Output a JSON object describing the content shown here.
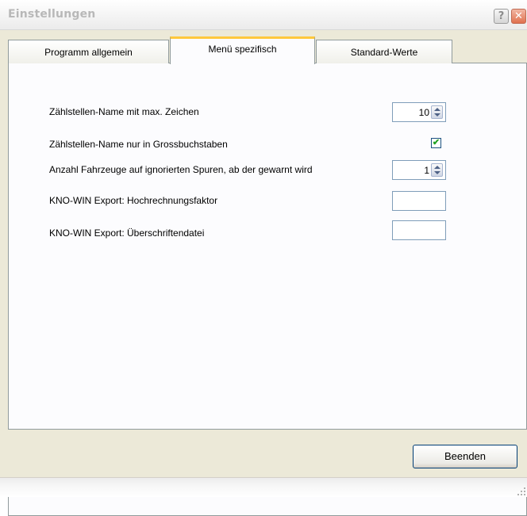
{
  "window": {
    "title": "Einstellungen",
    "help_glyph": "?",
    "close_glyph": "✕"
  },
  "tabs": [
    {
      "label": "Programm allgemein"
    },
    {
      "label": "Menü spezifisch",
      "active": true
    },
    {
      "label": "Standard-Werte"
    }
  ],
  "settings": [
    {
      "label": "Zählstellen-Name mit max. Zeichen",
      "type": "spin",
      "value": "10"
    },
    {
      "label": "Zählstellen-Name nur in Grossbuchstaben",
      "type": "checkbox",
      "checked": true,
      "check_glyph": "✔"
    },
    {
      "label": "Anzahl Fahrzeuge auf ignorierten Spuren, ab der gewarnt wird",
      "type": "spin",
      "value": "1"
    },
    {
      "label": "KNO-WIN Export: Hochrechnungsfaktor",
      "type": "text",
      "value": ""
    },
    {
      "label": "KNO-WIN Export: Überschriftendatei",
      "type": "text",
      "value": ""
    }
  ],
  "footer": {
    "close_button": "Beenden"
  },
  "icons": {
    "help": "help-icon",
    "close": "close-icon",
    "resize": "resize-grip-icon"
  },
  "colors": {
    "active_tab_accent": "#ffc83c",
    "field_border": "#7f9db9",
    "check_mark": "#21a121"
  }
}
